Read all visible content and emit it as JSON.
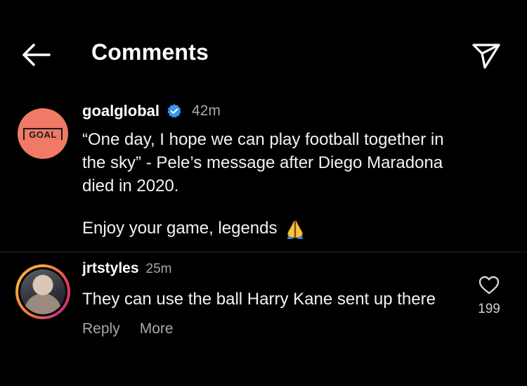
{
  "header": {
    "title": "Comments",
    "back_icon": "arrow-left-icon",
    "share_icon": "paper-plane-icon"
  },
  "post": {
    "username": "goalglobal",
    "verified_icon": "verified-badge-icon",
    "time": "42m",
    "avatar_label": "GOAL",
    "caption": "“One day, I hope we can play football together in\nthe sky” - Pele’s message after Diego Maradona\ndied in 2020.",
    "caption_end": "Enjoy your game, legends",
    "emoji_icon": "folded-hands-icon"
  },
  "comment": {
    "username": "jrtstyles",
    "time": "25m",
    "text": "They can use the ball Harry Kane sent up there",
    "reply_label": "Reply",
    "more_label": "More",
    "like_icon": "heart-outline-icon",
    "like_count": "199"
  },
  "colors": {
    "background": "#000000",
    "secondary_text": "#a8a8a8",
    "verified": "#3897f0",
    "goal_avatar": "#f07a66"
  }
}
